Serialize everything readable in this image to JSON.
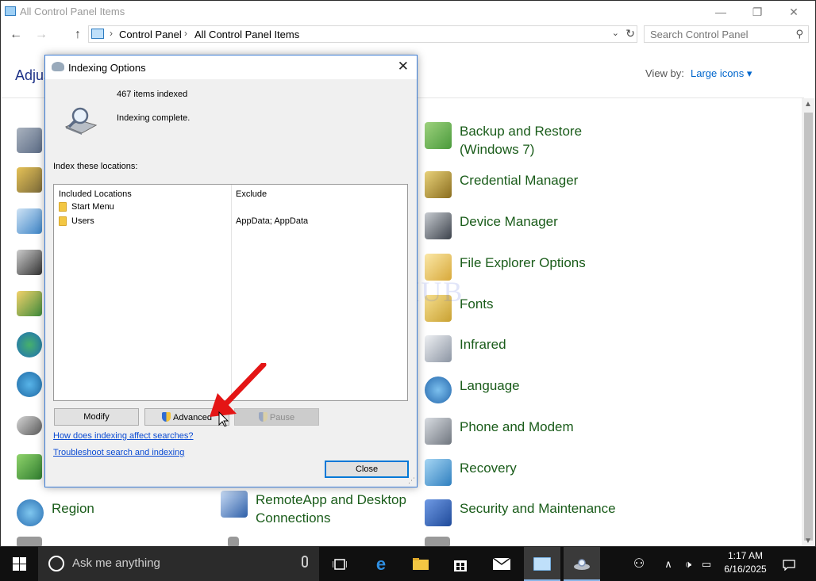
{
  "window": {
    "title": "All Control Panel Items",
    "minimize_glyph": "—",
    "restore_glyph": "❐",
    "close_glyph": "✕"
  },
  "nav": {
    "back": "←",
    "forward": "→",
    "up": "↑",
    "breadcrumb": [
      "Control Panel",
      "All Control Panel Items"
    ],
    "separator": "›",
    "dropdown": "⌄",
    "refresh": "↻"
  },
  "search": {
    "placeholder": "Search Control Panel",
    "icon": "⚲"
  },
  "header": {
    "adjust": "Adjus",
    "view_by_label": "View by:",
    "view_by_value": "Large icons ▾"
  },
  "items_right": [
    {
      "label": "Backup and Restore",
      "label2": "(Windows 7)",
      "icon": "backup-icon",
      "color": "#4a9a3b"
    },
    {
      "label": "Credential Manager",
      "icon": "credential-icon",
      "color": "#b7962c"
    },
    {
      "label": "Device Manager",
      "icon": "device-manager-icon",
      "color": "#555b66"
    },
    {
      "label": "File Explorer Options",
      "icon": "folder-options-icon",
      "color": "#e9c66a"
    },
    {
      "label": "Fonts",
      "icon": "fonts-icon",
      "color": "#e3c25b"
    },
    {
      "label": "Infrared",
      "icon": "infrared-icon",
      "color": "#9aa3b0"
    },
    {
      "label": "Language",
      "icon": "language-icon",
      "color": "#3a82c9"
    },
    {
      "label": "Phone and Modem",
      "icon": "phone-icon",
      "color": "#8a9099"
    },
    {
      "label": "Recovery",
      "icon": "recovery-icon",
      "color": "#3c8fc9"
    },
    {
      "label": "Security and Maintenance",
      "icon": "flag-icon",
      "color": "#2f5fb7"
    }
  ],
  "items_bottom": [
    {
      "label": "Region",
      "icon": "globe-icon",
      "color": "#3c8fc9"
    },
    {
      "label": "RemoteApp and Desktop",
      "label2": "Connections",
      "icon": "remoteapp-icon",
      "color": "#3a6fbf"
    }
  ],
  "watermark": "IT Pros HUB",
  "dialog": {
    "title": "Indexing Options",
    "close": "✕",
    "items_indexed": "467 items indexed",
    "status": "Indexing complete.",
    "index_label": "Index these locations:",
    "col_included": "Included Locations",
    "col_exclude": "Exclude",
    "locations": [
      {
        "name": "Start Menu",
        "exclude": ""
      },
      {
        "name": "Users",
        "exclude": "AppData; AppData"
      }
    ],
    "modify": "Modify",
    "advanced": "Advanced",
    "pause": "Pause",
    "link_how": "How does indexing affect searches?",
    "link_troubleshoot": "Troubleshoot search and indexing",
    "close_btn": "Close"
  },
  "taskbar": {
    "cortana_text": "Ask me anything",
    "time": "1:17 AM",
    "date": "6/16/2025",
    "accent": "#8ab6e8"
  }
}
